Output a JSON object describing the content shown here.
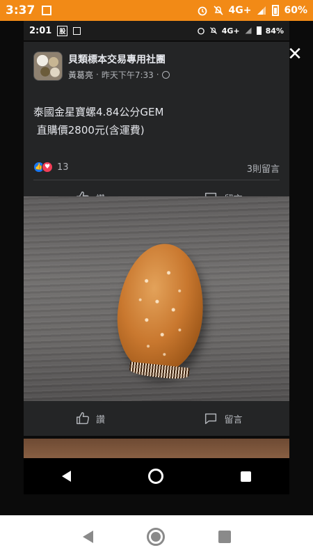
{
  "outer_status": {
    "time": "3:37",
    "network": "4G+",
    "battery": "60%",
    "icons": [
      "alarm-icon",
      "mute-icon",
      "signal-icon",
      "battery-icon"
    ]
  },
  "inner_status": {
    "time": "2:01",
    "badge": "股",
    "network": "4G+",
    "battery": "84%"
  },
  "post": {
    "group_name": "貝類標本交易專用社團",
    "author": "黃葛亮",
    "timestamp": "昨天下午7:33",
    "text_line1": "泰國金星寶螺4.84公分GEM",
    "text_line2": " 直購價2800元(含運費)",
    "reaction_count": "13",
    "comment_count": "3則留言",
    "like_label": "讚",
    "comment_label": "留言"
  },
  "photo_actions": {
    "like_label": "讚",
    "comment_label": "留言"
  },
  "close_label": "✕",
  "colors": {
    "status_bar": "#f28a16",
    "card_bg": "#242526",
    "like_blue": "#1877f2",
    "love_red": "#f33e58"
  }
}
